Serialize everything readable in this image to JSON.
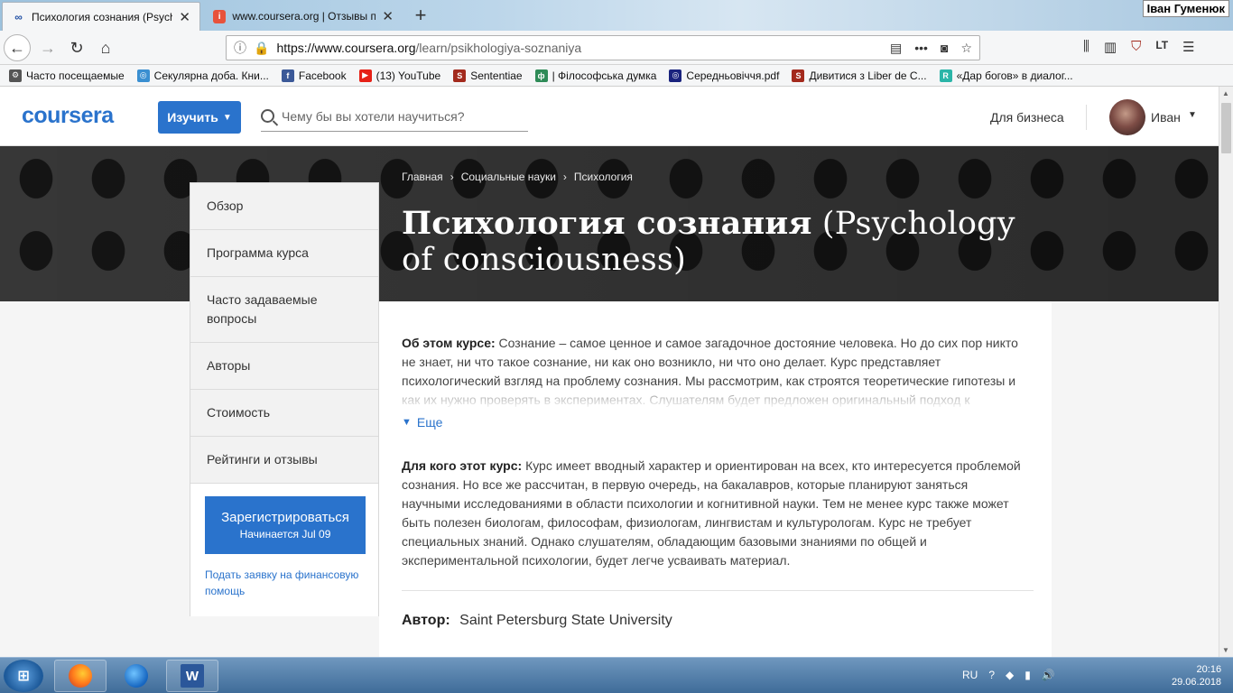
{
  "browser": {
    "tabs": [
      {
        "title": "Психология сознания (Psycho",
        "active": true,
        "favicon": "coursera-favicon-icon"
      },
      {
        "title": "www.coursera.org | Отзывы по",
        "active": false,
        "favicon": "irecommend-favicon-icon"
      }
    ],
    "new_tab": "+",
    "os_user": "Іван Гуменюк",
    "url_host": "https://www.coursera.org",
    "url_path": "/learn/psikhologiya-soznaniya",
    "bookmarks": [
      {
        "label": "Часто посещаемые",
        "icon": "gear-icon",
        "color": "#555555"
      },
      {
        "label": "Секулярна доба. Кни...",
        "icon": "globe-icon",
        "color": "#3a8fd1"
      },
      {
        "label": "Facebook",
        "icon": "facebook-icon",
        "color": "#3b5998"
      },
      {
        "label": "(13) YouTube",
        "icon": "youtube-icon",
        "color": "#e62117"
      },
      {
        "label": "Sententiae",
        "icon": "s-logo-icon",
        "color": "#a32a1d"
      },
      {
        "label": "| Філософська думка",
        "icon": "book-icon",
        "color": "#2e8b57"
      },
      {
        "label": "Середньовіччя.pdf",
        "icon": "globe-icon",
        "color": "#1a237e"
      },
      {
        "label": "Дивитися з Liber de C...",
        "icon": "s-logo-icon",
        "color": "#a32a1d"
      },
      {
        "label": "«Дар богов» в диалог...",
        "icon": "r-logo-icon",
        "color": "#2bb5a8"
      }
    ]
  },
  "header": {
    "logo": "coursera",
    "explore_label": "Изучить",
    "search_placeholder": "Чему бы вы хотели научиться?",
    "business_label": "Для бизнеса",
    "user_name": "Иван"
  },
  "banner": {
    "breadcrumbs": [
      "Главная",
      "Социальные науки",
      "Психология"
    ],
    "title_bold": "Психология сознания",
    "title_rest": " (Psychology of consciousness)"
  },
  "sidenav": {
    "items": [
      "Обзор",
      "Программа курса",
      "Часто задаваемые вопросы",
      "Авторы",
      "Стоимость",
      "Рейтинги и отзывы"
    ],
    "enroll_label": "Зарегистрироваться",
    "enroll_sub": "Начинается Jul 09",
    "finaid_label": "Подать заявку на финансовую помощь"
  },
  "about": {
    "label": "Об этом курсе:",
    "text": "Сознание – самое ценное и самое загадочное достояние человека. Но до сих пор никто не знает, ни что такое сознание, ни как оно возникло, ни что оно делает. Курс представляет психологический взгляд на проблему сознания. Мы рассмотрим, как строятся теоретические гипотезы и как их нужно проверять в экспериментах. Слушателям будет предложен оригинальный подход к",
    "more_label": "Еще"
  },
  "audience": {
    "label": "Для кого этот курс:",
    "text": "Курс имеет вводный характер и ориентирован на всех, кто интересуется проблемой сознания. Но все же рассчитан, в первую очередь, на бакалавров, которые планируют заняться научными исследованиями в области психологии и когнитивной науки. Тем не менее курс также может быть полезен биологам, философам, физиологам, лингвистам и культурологам. Курс не требует специальных знаний. Однако слушателям, обладающим базовыми знаниями по общей и экспериментальной психологии, будет легче усваивать материал."
  },
  "author": {
    "label": "Автор:",
    "value": "Saint Petersburg State University"
  },
  "taskbar": {
    "apps": [
      "firefox-icon",
      "browser-icon",
      "word-icon"
    ],
    "word_letter": "W",
    "lang": "RU",
    "time": "20:16",
    "date": "29.06.2018"
  },
  "colors": {
    "brand": "#2a73cc",
    "banner": "#3a3a3a"
  }
}
